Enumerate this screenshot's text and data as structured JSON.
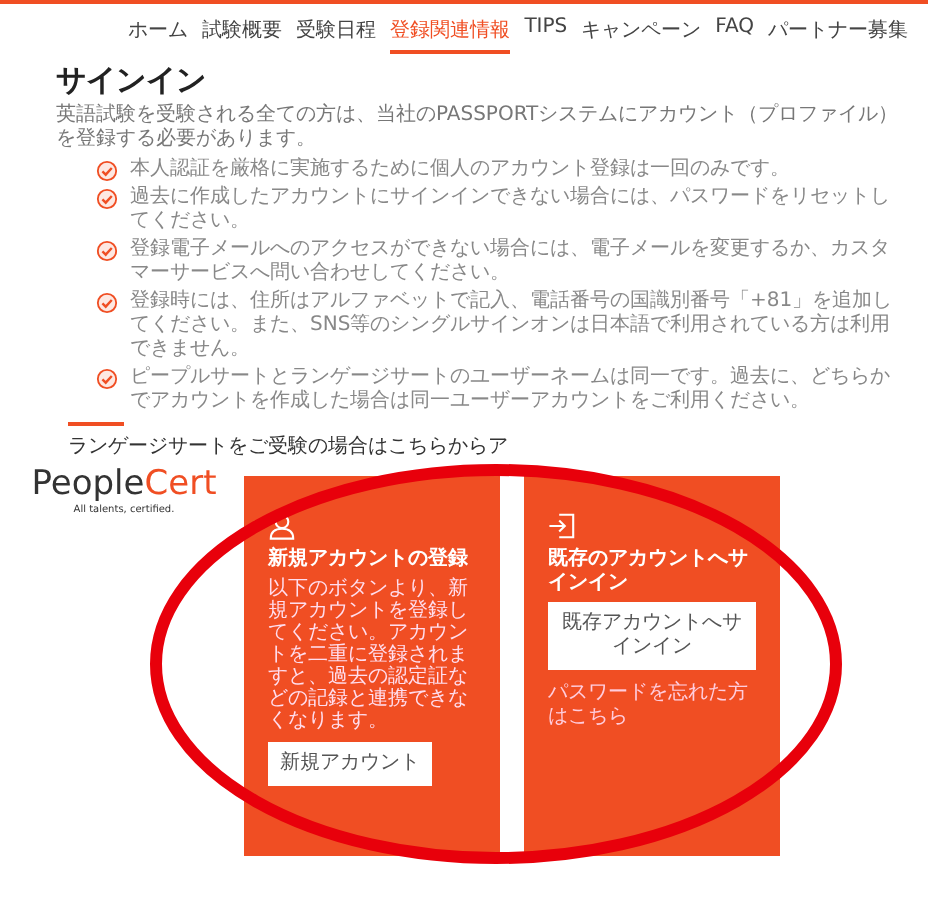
{
  "nav": [
    {
      "label": "ホーム",
      "selected": false
    },
    {
      "label": "試験概要",
      "selected": false
    },
    {
      "label": "受験日程",
      "selected": false
    },
    {
      "label": "登録関連情報",
      "selected": true
    },
    {
      "label": "TIPS",
      "selected": false
    },
    {
      "label": "キャンペーン",
      "selected": false
    },
    {
      "label": "FAQ",
      "selected": false
    },
    {
      "label": "パートナー募集",
      "selected": false
    }
  ],
  "title": "サインイン",
  "intro": "英語試験を受験される全ての方は、当社のPASSPORTシステムにアカウント（プロファイル）を登録する必要があります。",
  "notes": [
    "本人認証を厳格に実施するために個人のアカウント登録は一回のみです。",
    "過去に作成したアカウントにサインインできない場合には、パスワードをリセットしてください。",
    "登録電子メールへのアクセスができない場合には、電子メールを変更するか、カスタマーサービスへ問い合わせしてください。",
    "登録時には、住所はアルファベットで記入、電話番号の国識別番号「+81」を追加してください。また、SNS等のシングルサインオンは日本語で利用されている方は利用できません。",
    "ピープルサートとランゲージサートのユーザーネームは同一です。過去に、どちらかでアカウントを作成した場合は同一ユーザーアカウントをご利用ください。"
  ],
  "language_cert_note": "ランゲージサートをご受験の場合はこちらからア",
  "logo": {
    "name_dark": "People",
    "name_accent": "Cert",
    "tagline": "All talents, certified."
  },
  "cards": [
    {
      "kind": "register",
      "title": "新規アカウントの登録",
      "body": "以下のボタンより、新規アカウントを登録してください。アカウントを二重に登録されますと、過去の認定証などの記録と連携できなくなります。",
      "button": "新規アカウント"
    },
    {
      "kind": "signin",
      "title": "既存のアカウントへサインイン",
      "button": "既存アカウントへサインイン",
      "link": "パスワードを忘れた方はこちら"
    }
  ]
}
